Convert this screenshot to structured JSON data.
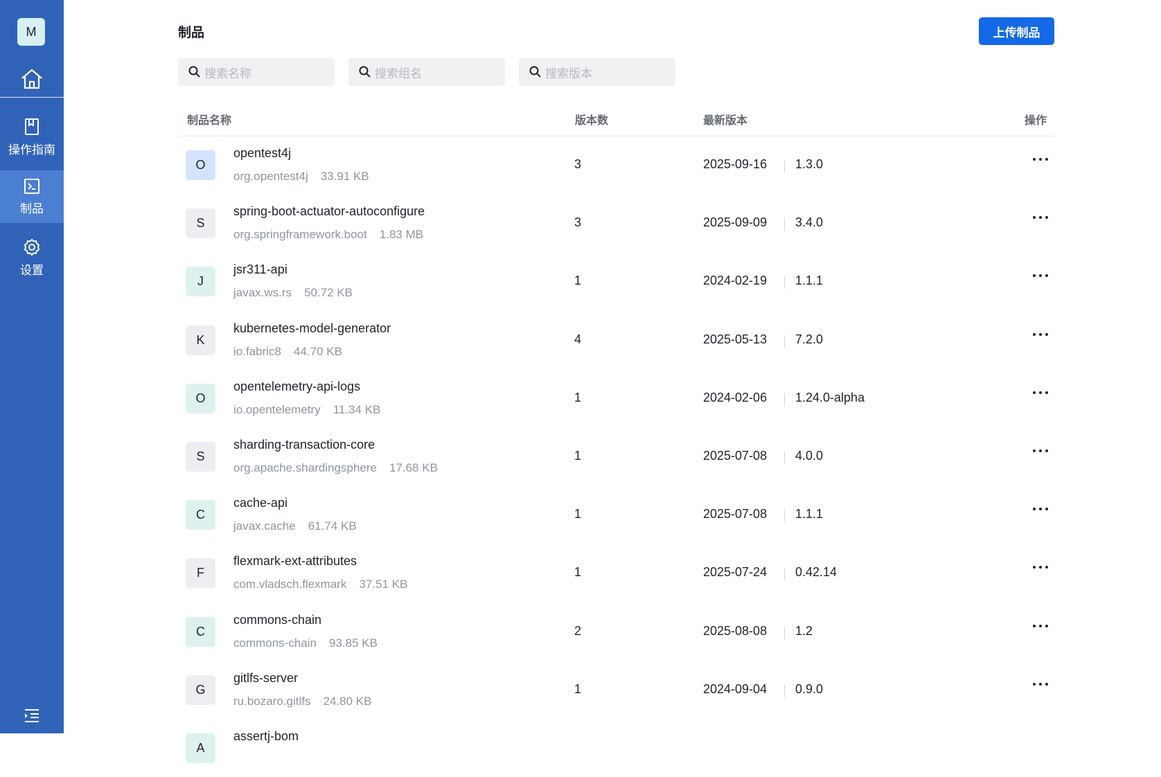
{
  "sidebar": {
    "avatar_letter": "M",
    "items": [
      {
        "label": "操作指南",
        "icon": "book-icon"
      },
      {
        "label": "制品",
        "icon": "terminal-icon"
      },
      {
        "label": "设置",
        "icon": "gear-icon"
      }
    ],
    "home_icon": "home-icon",
    "collapse_icon": "menu-collapse-icon",
    "active_item": "制品"
  },
  "header": {
    "title": "制品",
    "upload_label": "上传制品"
  },
  "search": {
    "name_placeholder": "搜索名称",
    "group_placeholder": "搜索组名",
    "version_placeholder": "搜索版本"
  },
  "table": {
    "columns": [
      "制品名称",
      "版本数",
      "最新版本",
      "操作"
    ],
    "rows": [
      {
        "letter": "O",
        "name": "opentest4j",
        "group": "org.opentest4j",
        "size": "33.91 KB",
        "count": "3",
        "date": "2025-09-16",
        "version": "1.3.0",
        "badge_color": "#d3e3fb"
      },
      {
        "letter": "S",
        "name": "spring-boot-actuator-autoconfigure",
        "group": "org.springframework.boot",
        "size": "1.83 MB",
        "count": "3",
        "date": "2025-09-09",
        "version": "3.4.0",
        "badge_color": "#eceef1"
      },
      {
        "letter": "J",
        "name": "jsr311-api",
        "group": "javax.ws.rs",
        "size": "50.72 KB",
        "count": "1",
        "date": "2024-02-19",
        "version": "1.1.1",
        "badge_color": "#ddf2ee"
      },
      {
        "letter": "K",
        "name": "kubernetes-model-generator",
        "group": "io.fabric8",
        "size": "44.70 KB",
        "count": "4",
        "date": "2025-05-13",
        "version": "7.2.0",
        "badge_color": "#eceef1"
      },
      {
        "letter": "O",
        "name": "opentelemetry-api-logs",
        "group": "io.opentelemetry",
        "size": "11.34 KB",
        "count": "1",
        "date": "2024-02-06",
        "version": "1.24.0-alpha",
        "badge_color": "#ddf2ee"
      },
      {
        "letter": "S",
        "name": "sharding-transaction-core",
        "group": "org.apache.shardingsphere",
        "size": "17.68 KB",
        "count": "1",
        "date": "2025-07-08",
        "version": "4.0.0",
        "badge_color": "#eceef1"
      },
      {
        "letter": "C",
        "name": "cache-api",
        "group": "javax.cache",
        "size": "61.74 KB",
        "count": "1",
        "date": "2025-07-08",
        "version": "1.1.1",
        "badge_color": "#ddf2ee"
      },
      {
        "letter": "F",
        "name": "flexmark-ext-attributes",
        "group": "com.vladsch.flexmark",
        "size": "37.51 KB",
        "count": "1",
        "date": "2025-07-24",
        "version": "0.42.14",
        "badge_color": "#eceef1"
      },
      {
        "letter": "C",
        "name": "commons-chain",
        "group": "commons-chain",
        "size": "93.85 KB",
        "count": "2",
        "date": "2025-08-08",
        "version": "1.2",
        "badge_color": "#ddf2ee"
      },
      {
        "letter": "G",
        "name": "gitlfs-server",
        "group": "ru.bozaro.gitlfs",
        "size": "24.80 KB",
        "count": "1",
        "date": "2024-09-04",
        "version": "0.9.0",
        "badge_color": "#eceef1"
      },
      {
        "letter": "A",
        "name": "assertj-bom",
        "group": "",
        "size": "",
        "count": "",
        "date": "",
        "version": "",
        "badge_color": "#ddf2ee"
      }
    ]
  },
  "colors": {
    "sidebar_bg": "#3063b8",
    "sidebar_active": "#4a7fd1",
    "primary_button": "#1469e6"
  }
}
